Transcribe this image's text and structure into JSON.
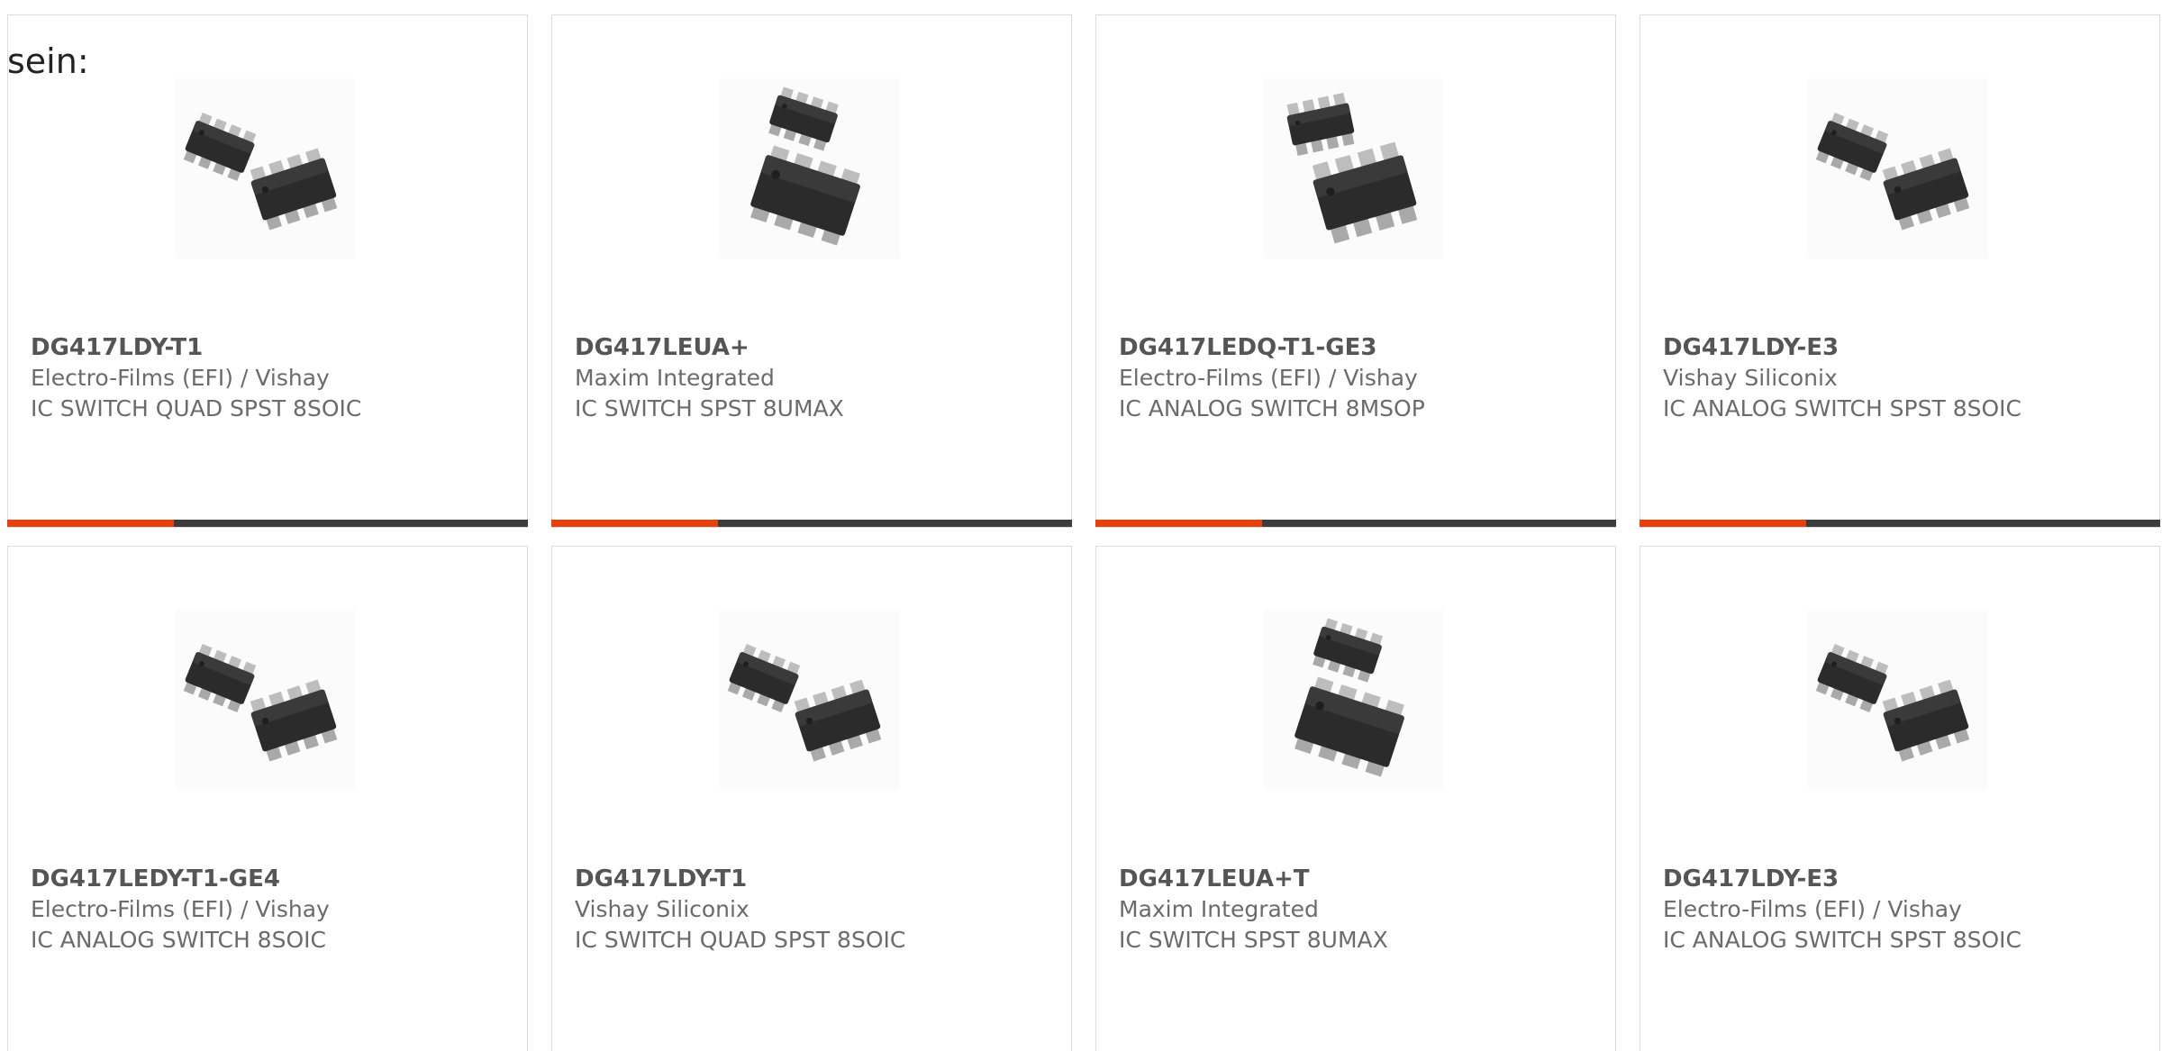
{
  "intro_text": "sein:",
  "colors": {
    "accent": "#e8400c",
    "bar": "#3c3c3c",
    "title": "#555555",
    "text": "#6b6b6b",
    "border": "#dcdcdc"
  },
  "products": [
    {
      "part_number": "DG417LDY-T1",
      "manufacturer": "Electro-Films (EFI) / Vishay",
      "description": "IC SWITCH QUAD SPST 8SOIC",
      "package_icon": "soic-8-pair-icon",
      "progress": 0.32
    },
    {
      "part_number": "DG417LEUA+",
      "manufacturer": "Maxim Integrated",
      "description": "IC SWITCH SPST 8UMAX",
      "package_icon": "umax-8-pair-icon",
      "progress": 0.32
    },
    {
      "part_number": "DG417LEDQ-T1-GE3",
      "manufacturer": "Electro-Films (EFI) / Vishay",
      "description": "IC ANALOG SWITCH 8MSOP",
      "package_icon": "msop-8-pair-icon",
      "progress": 0.32
    },
    {
      "part_number": "DG417LDY-E3",
      "manufacturer": "Vishay Siliconix",
      "description": "IC ANALOG SWITCH SPST 8SOIC",
      "package_icon": "soic-8-pair-icon",
      "progress": 0.32
    },
    {
      "part_number": "DG417LEDY-T1-GE4",
      "manufacturer": "Electro-Films (EFI) / Vishay",
      "description": "IC ANALOG SWITCH 8SOIC",
      "package_icon": "soic-8-pair-icon",
      "progress": null
    },
    {
      "part_number": "DG417LDY-T1",
      "manufacturer": "Vishay Siliconix",
      "description": "IC SWITCH QUAD SPST 8SOIC",
      "package_icon": "soic-8-pair-icon",
      "progress": null
    },
    {
      "part_number": "DG417LEUA+T",
      "manufacturer": "Maxim Integrated",
      "description": "IC SWITCH SPST 8UMAX",
      "package_icon": "umax-8-pair-icon",
      "progress": null
    },
    {
      "part_number": "DG417LDY-E3",
      "manufacturer": "Electro-Films (EFI) / Vishay",
      "description": "IC ANALOG SWITCH SPST 8SOIC",
      "package_icon": "soic-8-pair-icon",
      "progress": null
    }
  ]
}
